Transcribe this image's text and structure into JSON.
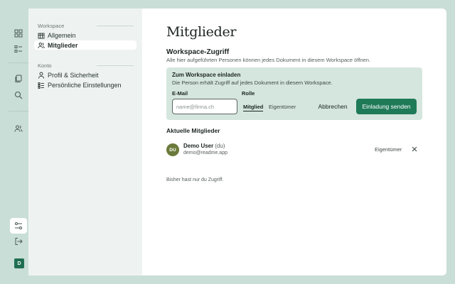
{
  "rail": {
    "icons": [
      "grid-icon",
      "checklist-icon",
      "documents-icon",
      "search-icon",
      "users-icon",
      "settings-sliders-icon",
      "logout-icon"
    ],
    "avatar_initial": "D"
  },
  "nav": {
    "workspace_section": "Workspace",
    "items_workspace": [
      {
        "label": "Allgemein",
        "icon": "building-icon"
      },
      {
        "label": "Mitglieder",
        "icon": "members-icon"
      }
    ],
    "account_section": "Konto",
    "items_account": [
      {
        "label": "Profil & Sicherheit",
        "icon": "user-icon"
      },
      {
        "label": "Persönliche Einstellungen",
        "icon": "preferences-icon"
      }
    ]
  },
  "main": {
    "title": "Mitglieder",
    "access": {
      "title": "Workspace-Zugriff",
      "description": "Alle hier aufgeführten Personen können jedes Dokument in diesem Workspace öffnen."
    },
    "invite": {
      "title": "Zum Workspace einladen",
      "description": "Die Person erhält Zugriff auf jedes Dokument in diesem Workspace.",
      "email_label": "E-Mail",
      "email_placeholder": "name@firma.ch",
      "email_value": "",
      "role_label": "Rolle",
      "roles": [
        "Mitglied",
        "Eigentümer"
      ],
      "selected_role": "Mitglied",
      "cancel_label": "Abbrechen",
      "submit_label": "Einladung senden"
    },
    "members": {
      "title": "Aktuelle Mitglieder",
      "list": [
        {
          "initials": "DU",
          "name": "Demo User",
          "you_tag": "(du)",
          "email": "demo@readme.app",
          "role": "Eigentümer"
        }
      ],
      "note": "Bisher hast nur du Zugriff."
    }
  },
  "colors": {
    "background": "#c9ded6",
    "accent": "#1f7a58",
    "invite_panel": "#d5e6de",
    "avatar": "#6b7a3a"
  }
}
